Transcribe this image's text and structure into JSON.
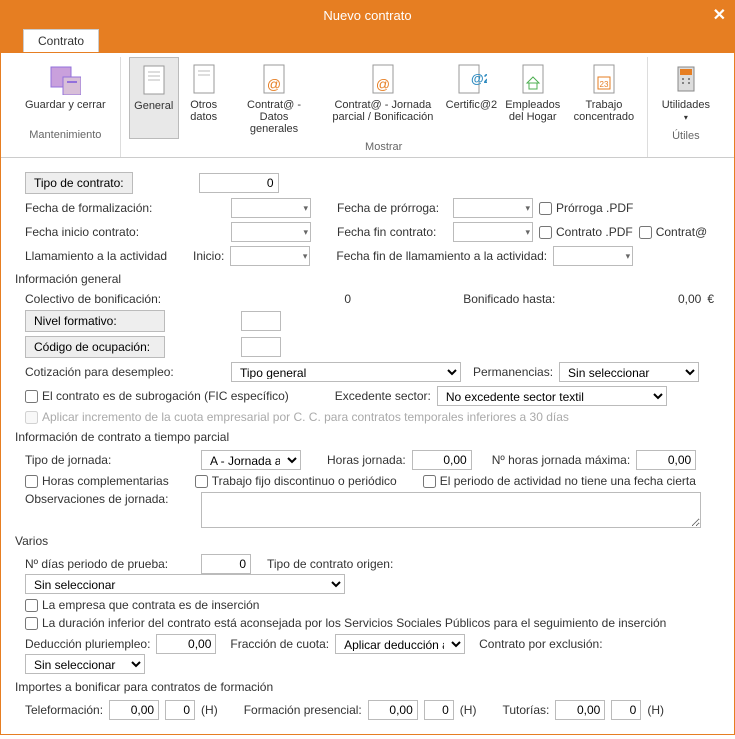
{
  "title": "Nuevo contrato",
  "tab": "Contrato",
  "ribbon": {
    "maintenance": {
      "name": "Mantenimiento",
      "save": "Guardar y cerrar"
    },
    "show": {
      "name": "Mostrar",
      "general": "General",
      "otros": "Otros datos",
      "datos_gen": "Contrat@ - Datos generales",
      "jornada": "Contrat@ - Jornada parcial / Bonificación",
      "certific": "Certific@2",
      "empleados": "Empleados del Hogar",
      "trabajo": "Trabajo concentrado"
    },
    "utiles": {
      "name": "Útiles",
      "utilidades": "Utilidades"
    }
  },
  "f": {
    "tipo_contrato_btn": "Tipo de contrato:",
    "tipo_contrato_val": "0",
    "fecha_form": "Fecha de formalización:",
    "fecha_prorroga": "Fecha de prórroga:",
    "chk_prorroga_pdf": "Prórroga .PDF",
    "fecha_inicio": "Fecha inicio contrato:",
    "fecha_fin": "Fecha fin contrato:",
    "chk_contrato_pdf": "Contrato .PDF",
    "chk_contrata": "Contrat@",
    "llamamiento": "Llamamiento a la actividad",
    "inicio": "Inicio:",
    "fecha_fin_llam": "Fecha fin de llamamiento a la actividad:"
  },
  "sec_info_gen": "Información general",
  "ig": {
    "colectivo": "Colectivo de bonificación:",
    "colectivo_val": "0",
    "bonificado": "Bonificado hasta:",
    "bonificado_val": "0,00",
    "euro": "€",
    "nivel_btn": "Nivel formativo:",
    "codigo_btn": "Código de ocupación:",
    "cotiz": "Cotización para desempleo:",
    "cotiz_val": "Tipo general",
    "perm": "Permanencias:",
    "perm_val": "Sin seleccionar",
    "chk_subrog": "El contrato es de subrogación (FIC específico)",
    "excedente": "Excedente sector:",
    "excedente_val": "No excedente sector textil",
    "chk_aplicar": "Aplicar incremento de la cuota empresarial por C. C. para contratos temporales inferiores a 30 días"
  },
  "sec_tp": "Información de contrato a tiempo parcial",
  "tp": {
    "tipo_jornada": "Tipo de jornada:",
    "tipo_jornada_val": "A - Jornada al",
    "horas_jornada": "Horas jornada:",
    "horas_jornada_val": "0,00",
    "n_horas_max": "Nº horas jornada máxima:",
    "n_horas_max_val": "0,00",
    "chk_compl": "Horas complementarias",
    "chk_fijo": "Trabajo fijo discontinuo o periódico",
    "chk_periodo": "El periodo de actividad no tiene una fecha cierta",
    "obs": "Observaciones de jornada:"
  },
  "sec_varios": "Varios",
  "v": {
    "n_dias": "Nº días periodo de prueba:",
    "n_dias_val": "0",
    "tipo_origen": "Tipo de contrato origen:",
    "tipo_origen_val": "Sin seleccionar",
    "chk_empresa": "La empresa que contrata es de inserción",
    "chk_duracion": "La duración inferior del contrato está aconsejada por los Servicios Sociales Públicos para el seguimiento de inserción",
    "deduccion": "Deducción pluriempleo:",
    "deduccion_val": "0,00",
    "fraccion": "Fracción de cuota:",
    "fraccion_val": "Aplicar deducción a",
    "contrato_excl": "Contrato por exclusión:",
    "contrato_excl_val": "Sin seleccionar"
  },
  "sec_imp": "Importes a bonificar para contratos de formación",
  "imp": {
    "tele": "Teleformación:",
    "tele_v1": "0,00",
    "tele_v2": "0",
    "h": "(H)",
    "form": "Formación presencial:",
    "form_v1": "0,00",
    "form_v2": "0",
    "tut": "Tutorías:",
    "tut_v1": "0,00",
    "tut_v2": "0"
  }
}
